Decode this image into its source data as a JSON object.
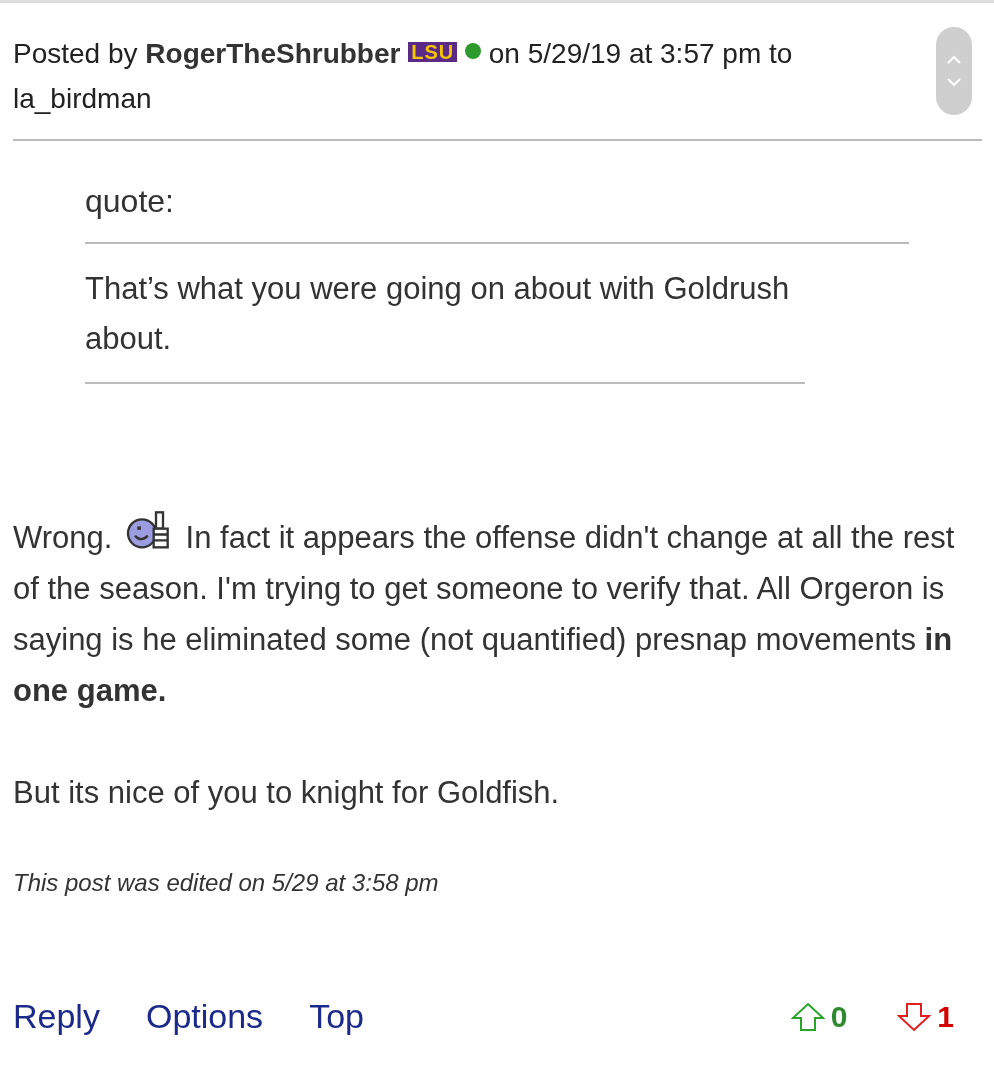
{
  "post_header": {
    "prefix": "Posted by",
    "author": "RogerTheShrubber",
    "team_badge": "LSU",
    "online": true,
    "suffix": "on 5/29/19 at 3:57 pm to",
    "recipient": "la_birdman"
  },
  "quote": {
    "label": "quote:",
    "text": "That’s what you were going on about with Goldrush about."
  },
  "body": [
    {
      "before_icon": "Wrong.",
      "text": "In fact it appears the offense didn't change at all the rest of the season. I'm trying to get someone to verify that. All Orgeron is saying is he eliminated some (not quantified) presnap movements **in one game.**"
    },
    {
      "text": "But its nice of you to knight for Goldfish."
    }
  ],
  "edit_note": "This post was edited on 5/29 at 3:58 pm",
  "actions": [
    "Reply",
    "Options",
    "Top"
  ],
  "votes": {
    "up": "0",
    "down": "1"
  }
}
